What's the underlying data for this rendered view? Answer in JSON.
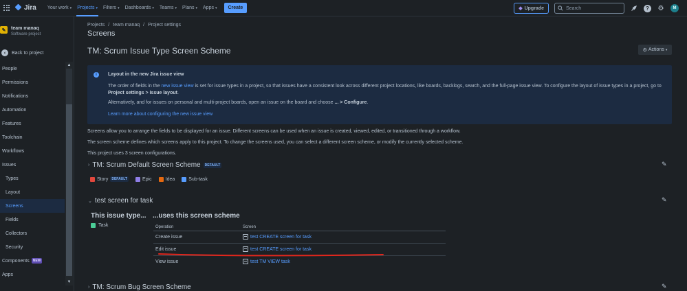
{
  "topnav": {
    "logo": "Jira",
    "items": [
      {
        "label": "Your work"
      },
      {
        "label": "Projects"
      },
      {
        "label": "Filters"
      },
      {
        "label": "Dashboards"
      },
      {
        "label": "Teams"
      },
      {
        "label": "Plans"
      },
      {
        "label": "Apps"
      }
    ],
    "active_index": 1,
    "create_label": "Create",
    "upgrade_label": "Upgrade",
    "search_placeholder": "Search",
    "avatar_initial": "M"
  },
  "sidebar": {
    "project_name": "team manaq",
    "project_type": "Software project",
    "back_label": "Back to project",
    "items": [
      {
        "label": "People"
      },
      {
        "label": "Permissions"
      },
      {
        "label": "Notifications"
      },
      {
        "label": "Automation"
      },
      {
        "label": "Features"
      },
      {
        "label": "Toolchain"
      },
      {
        "label": "Workflows"
      },
      {
        "label": "Issues"
      },
      {
        "label": "Types"
      },
      {
        "label": "Layout"
      },
      {
        "label": "Screens"
      },
      {
        "label": "Fields"
      },
      {
        "label": "Collectors"
      },
      {
        "label": "Security"
      },
      {
        "label": "Components"
      },
      {
        "label": "Apps"
      }
    ],
    "new_badge": "NEW"
  },
  "breadcrumb": {
    "items": [
      "Projects",
      "team manaq",
      "Project settings"
    ],
    "sep": "/"
  },
  "page_title": "Screens",
  "scheme_title": "TM: Scrum Issue Type Screen Scheme",
  "actions_label": "Actions",
  "info": {
    "title": "Layout in the new Jira issue view",
    "p1_a": "The order of fields in the ",
    "p1_link": "new issue view",
    "p1_b": " is set for issue types in a project, so that issues have a consistent look across different project locations, like boards, backlogs, search, and the full-page issue view. To configure the layout of issue types in a project, go to ",
    "p1_bold": "Project settings > Issue layout",
    "p1_end": ".",
    "p2_a": "Alternatively, and for issues on personal and multi-project boards, open an issue on the board and choose ",
    "p2_bold": "... > Configure",
    "p2_end": ".",
    "link": "Learn more about configuring the new issue view"
  },
  "paragraphs": {
    "p1": "Screens allow you to arrange the fields to be displayed for an issue. Different screens can be used when an issue is created, viewed, edited, or transitioned through a workflow.",
    "p2": "The screen scheme defines which screens apply to this project. To change the screens used, you can select a different screen scheme, or modify the currently selected scheme.",
    "p3": "This project uses 3 screen configurations."
  },
  "sections": {
    "default_scheme": {
      "title": "TM: Scrum Default Screen Scheme",
      "badge": "DEFAULT",
      "issue_types": [
        {
          "label": "Story",
          "badge": "DEFAULT"
        },
        {
          "label": "Epic"
        },
        {
          "label": "Idea"
        },
        {
          "label": "Sub-task"
        }
      ]
    },
    "task_scheme": {
      "title": "test screen for task",
      "col1_head": "This issue type...",
      "col2_head": "...uses this screen scheme",
      "issue_type": "Task",
      "table_head": {
        "operation": "Operation",
        "screen": "Screen"
      },
      "rows": [
        {
          "operation": "Create issue",
          "screen": "test CREATE screen for task"
        },
        {
          "operation": "Edit issue",
          "screen": "test CREATE screen for task"
        },
        {
          "operation": "View issue",
          "screen": "test TM VIEW task"
        }
      ]
    },
    "bug_scheme": {
      "title": "TM: Scrum Bug Screen Scheme"
    }
  },
  "colors": {
    "accent": "#579dff",
    "annotation_red": "#e2261c"
  }
}
